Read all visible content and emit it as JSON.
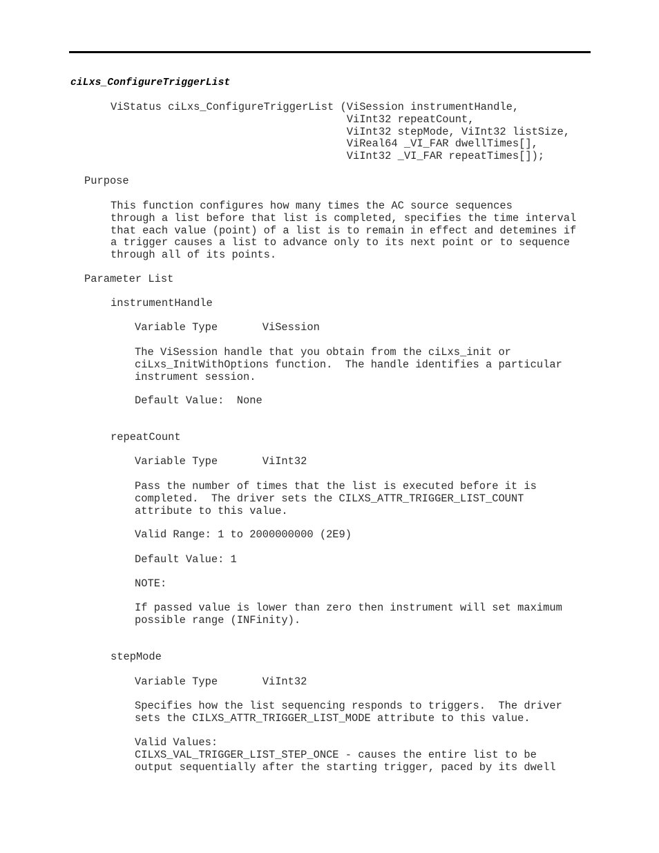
{
  "document": {
    "function_title": "ciLxs_ConfigureTriggerList",
    "signature": "ViStatus ciLxs_ConfigureTriggerList (ViSession instrumentHandle,\n                                     ViInt32 repeatCount,\n                                     ViInt32 stepMode, ViInt32 listSize,\n                                     ViReal64 _VI_FAR dwellTimes[],\n                                     ViInt32 _VI_FAR repeatTimes[]);",
    "sections": {
      "purpose": {
        "heading": "Purpose",
        "body": "This function configures how many times the AC source sequences\nthrough a list before that list is completed, specifies the time interval\nthat each value (point) of a list is to remain in effect and detemines if\na trigger causes a list to advance only to its next point or to sequence\nthrough all of its points."
      },
      "parameter_list": {
        "heading": "Parameter List",
        "parameters": [
          {
            "name": "instrumentHandle",
            "variable_type_line": "Variable Type       ViSession",
            "variable_type_label": "Variable Type",
            "variable_type_value": "ViSession",
            "description": "The ViSession handle that you obtain from the ciLxs_init or\nciLxs_InitWithOptions function.  The handle identifies a particular\ninstrument session.",
            "default_value": "Default Value:  None"
          },
          {
            "name": "repeatCount",
            "variable_type_line": "Variable Type       ViInt32",
            "variable_type_label": "Variable Type",
            "variable_type_value": "ViInt32",
            "description": "Pass the number of times that the list is executed before it is\ncompleted.  The driver sets the CILXS_ATTR_TRIGGER_LIST_COUNT\nattribute to this value.",
            "valid_range": "Valid Range: 1 to 2000000000 (2E9)",
            "default_value": "Default Value: 1",
            "note_heading": "NOTE:",
            "note_body": "If passed value is lower than zero then instrument will set maximum\npossible range (INFinity)."
          },
          {
            "name": "stepMode",
            "variable_type_line": "Variable Type       ViInt32",
            "variable_type_label": "Variable Type",
            "variable_type_value": "ViInt32",
            "description": "Specifies how the list sequencing responds to triggers.  The driver\nsets the CILXS_ATTR_TRIGGER_LIST_MODE attribute to this value.",
            "valid_values": "Valid Values:\nCILXS_VAL_TRIGGER_LIST_STEP_ONCE - causes the entire list to be\noutput sequentially after the starting trigger, paced by its dwell"
          }
        ]
      }
    }
  }
}
